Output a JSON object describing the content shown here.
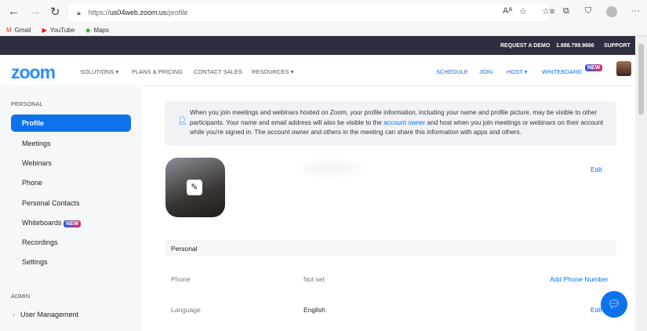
{
  "browser": {
    "url_prefix": "https://",
    "url_host": "us04web.zoom.us",
    "url_path": "/profile",
    "bookmarks": [
      "Gmail",
      "YouTube",
      "Maps"
    ]
  },
  "topbar": {
    "request_demo": "REQUEST A DEMO",
    "phone": "1.888.799.9666",
    "support": "SUPPORT"
  },
  "nav": {
    "logo": "zoom",
    "solutions": "SOLUTIONS ▾",
    "plans": "PLANS & PRICING",
    "contact": "CONTACT SALES",
    "resources": "RESOURCES ▾",
    "schedule": "SCHEDULE",
    "join": "JOIN",
    "host": "HOST ▾",
    "whiteboard": "WHITEBOARD",
    "new_badge": "NEW"
  },
  "sidebar": {
    "personal_header": "PERSONAL",
    "items": [
      "Profile",
      "Meetings",
      "Webinars",
      "Phone",
      "Personal Contacts",
      "Whiteboards",
      "Recordings",
      "Settings"
    ],
    "new_badge": "NEW",
    "admin_header": "ADMIN",
    "admin_items": [
      "User Management"
    ]
  },
  "notice": {
    "text1": "When you join meetings and webinars hosted on Zoom, your profile information, including your name and profile picture, may be visible to other participants. Your name and email address will also be visible to the ",
    "link": "account owner",
    "text2": " and host when you join meetings or webinars on their account while you're signed in. The account owner and others in the meeting can share this information with apps and others."
  },
  "profile": {
    "edit": "Edit",
    "section": "Personal",
    "phone_label": "Phone",
    "phone_value": "Not set",
    "add_phone": "Add Phone Number",
    "language_label": "Language",
    "language_value": "English",
    "edit2": "Edit"
  }
}
